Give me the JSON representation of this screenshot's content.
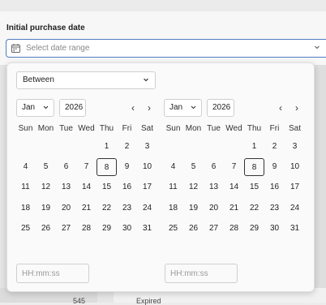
{
  "field": {
    "label": "Initial purchase date",
    "placeholder": "Select date range"
  },
  "range_mode": {
    "selected": "Between"
  },
  "calendars": [
    {
      "month": "Jan",
      "year": "2026"
    },
    {
      "month": "Jan",
      "year": "2026"
    }
  ],
  "nav": {
    "prev": "‹",
    "next": "›"
  },
  "weekdays": [
    "Sun",
    "Mon",
    "Tue",
    "Wed",
    "Thu",
    "Fri",
    "Sat"
  ],
  "weeks": [
    [
      "",
      "",
      "",
      "",
      "1",
      "2",
      "3"
    ],
    [
      "4",
      "5",
      "6",
      "7",
      "8",
      "9",
      "10"
    ],
    [
      "11",
      "12",
      "13",
      "14",
      "15",
      "16",
      "17"
    ],
    [
      "18",
      "19",
      "20",
      "21",
      "22",
      "23",
      "24"
    ],
    [
      "25",
      "26",
      "27",
      "28",
      "29",
      "30",
      "31"
    ]
  ],
  "today": "8",
  "time": {
    "placeholder": "HH:mm:ss"
  },
  "background": {
    "number": "545",
    "text": "Expired"
  },
  "icons": {
    "calendar": "calendar-icon",
    "chevron": "chevron-down-icon"
  },
  "colors": {
    "focus_border": "#4f7cc2"
  }
}
